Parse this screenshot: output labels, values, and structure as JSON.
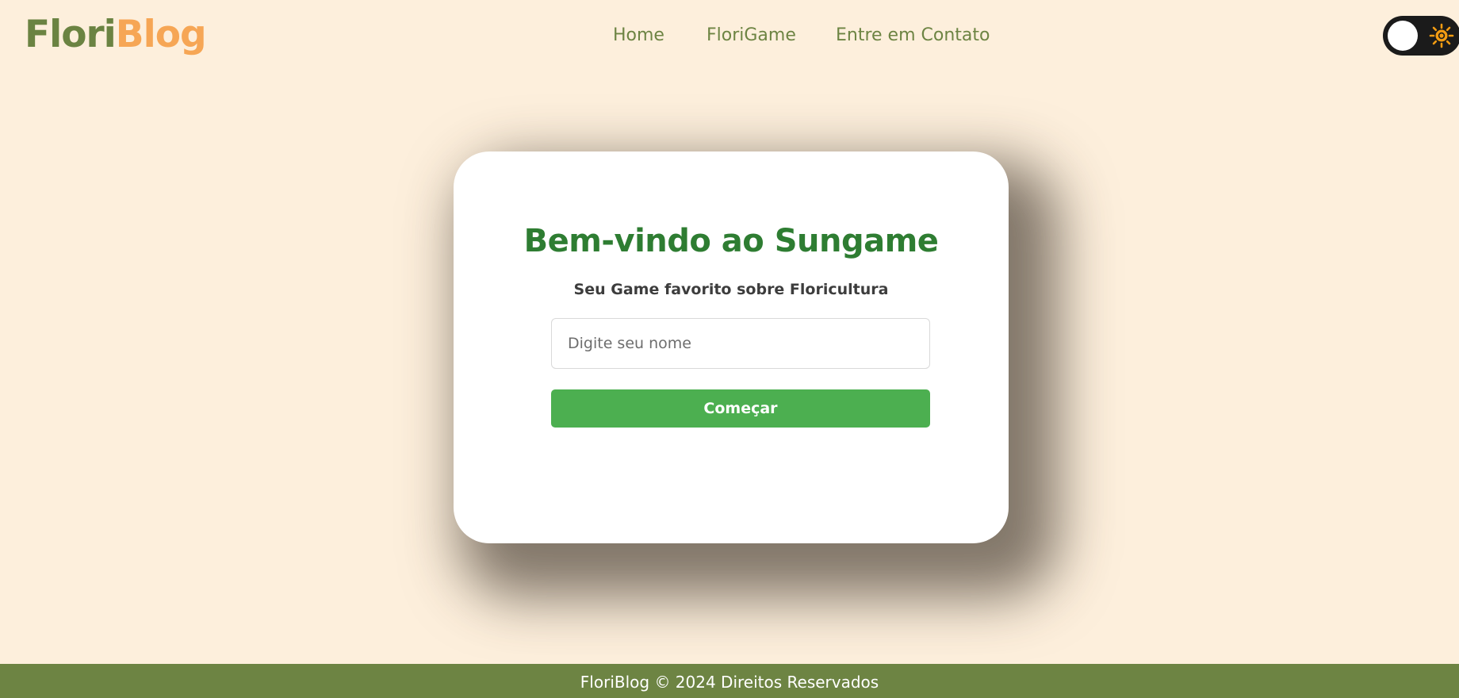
{
  "brand": {
    "logo_part1": "Flori",
    "logo_part2": "Blog",
    "colors": {
      "primary_green": "#6d8443",
      "accent_orange": "#f6a655",
      "page_background": "#fdefdc",
      "heading_green": "#2e7d32",
      "button_green": "#4caf50"
    }
  },
  "nav": {
    "items": [
      {
        "label": "Home"
      },
      {
        "label": "FloriGame"
      },
      {
        "label": "Entre em Contato"
      }
    ]
  },
  "theme_toggle": {
    "icons": [
      "toggle-knob",
      "sun-icon"
    ],
    "state": "light"
  },
  "card": {
    "title": "Bem-vindo ao Sungame",
    "subtitle": "Seu Game favorito sobre Floricultura",
    "name_input": {
      "placeholder": "Digite seu nome",
      "value": ""
    },
    "start_button": "Começar"
  },
  "footer": {
    "text": "FloriBlog © 2024 Direitos Reservados"
  }
}
